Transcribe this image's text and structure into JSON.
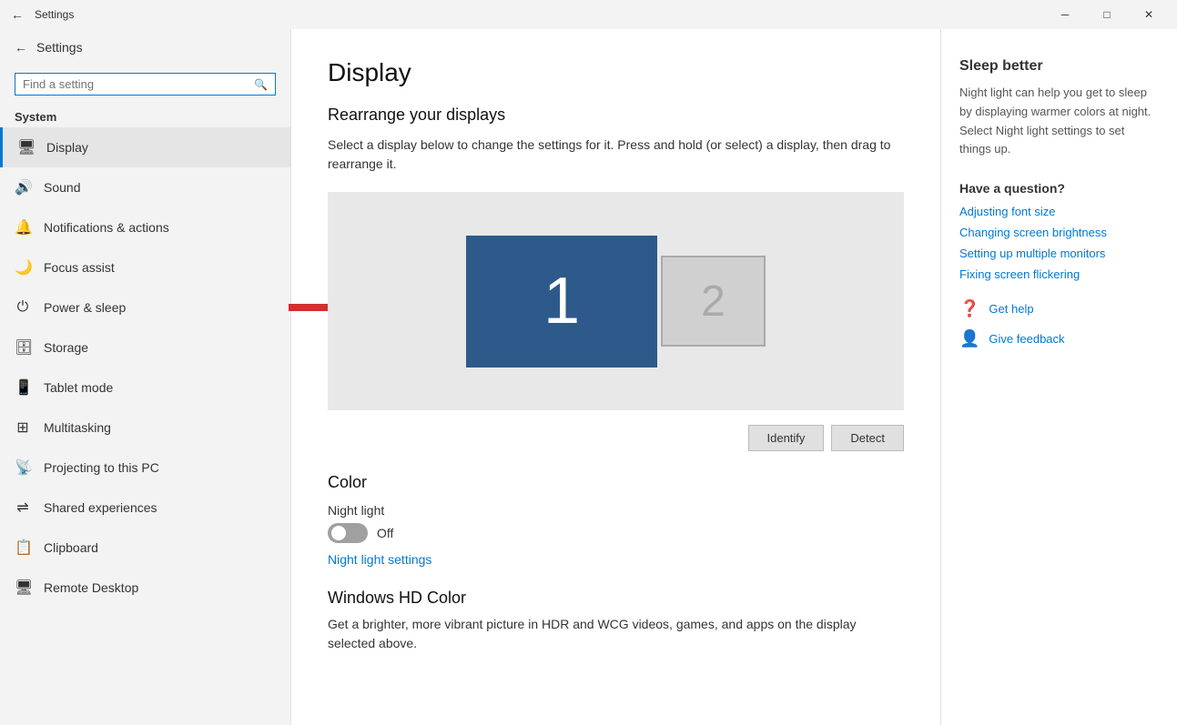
{
  "titlebar": {
    "back_icon": "←",
    "title": "Settings",
    "minimize_icon": "─",
    "maximize_icon": "□",
    "close_icon": "✕"
  },
  "sidebar": {
    "back_label": "Settings",
    "search_placeholder": "Find a setting",
    "search_icon": "🔍",
    "section_label": "System",
    "nav_items": [
      {
        "id": "display",
        "icon": "🖥",
        "label": "Display",
        "active": true
      },
      {
        "id": "sound",
        "icon": "🔊",
        "label": "Sound",
        "active": false
      },
      {
        "id": "notifications",
        "icon": "🔔",
        "label": "Notifications & actions",
        "active": false
      },
      {
        "id": "focus",
        "icon": "🌙",
        "label": "Focus assist",
        "active": false
      },
      {
        "id": "power",
        "icon": "⏻",
        "label": "Power & sleep",
        "active": false,
        "has_arrow": true
      },
      {
        "id": "storage",
        "icon": "🖫",
        "label": "Storage",
        "active": false
      },
      {
        "id": "tablet",
        "icon": "📱",
        "label": "Tablet mode",
        "active": false
      },
      {
        "id": "multitasking",
        "icon": "⊞",
        "label": "Multitasking",
        "active": false
      },
      {
        "id": "projecting",
        "icon": "📡",
        "label": "Projecting to this PC",
        "active": false
      },
      {
        "id": "shared",
        "icon": "⇌",
        "label": "Shared experiences",
        "active": false
      },
      {
        "id": "clipboard",
        "icon": "📋",
        "label": "Clipboard",
        "active": false
      },
      {
        "id": "remote",
        "icon": "🖵",
        "label": "Remote Desktop",
        "active": false
      }
    ]
  },
  "main": {
    "page_title": "Display",
    "rearrange_title": "Rearrange your displays",
    "rearrange_desc": "Select a display below to change the settings for it. Press and hold (or select) a display, then drag to rearrange it.",
    "monitor1_num": "1",
    "monitor2_num": "2",
    "identify_btn": "Identify",
    "detect_btn": "Detect",
    "color_title": "Color",
    "night_light_label": "Night light",
    "toggle_state": "Off",
    "night_light_settings_link": "Night light settings",
    "winhd_title": "Windows HD Color",
    "winhd_desc": "Get a brighter, more vibrant picture in HDR and WCG videos, games, and apps on the display selected above."
  },
  "right_panel": {
    "sleep_better_title": "Sleep better",
    "sleep_better_desc": "Night light can help you get to sleep by displaying warmer colors at night. Select Night light settings to set things up.",
    "have_question": "Have a question?",
    "links": [
      {
        "label": "Adjusting font size"
      },
      {
        "label": "Changing screen brightness"
      },
      {
        "label": "Setting up multiple monitors"
      },
      {
        "label": "Fixing screen flickering"
      }
    ],
    "get_help": "Get help",
    "give_feedback": "Give feedback",
    "help_icon": "❓",
    "feedback_icon": "👤"
  }
}
